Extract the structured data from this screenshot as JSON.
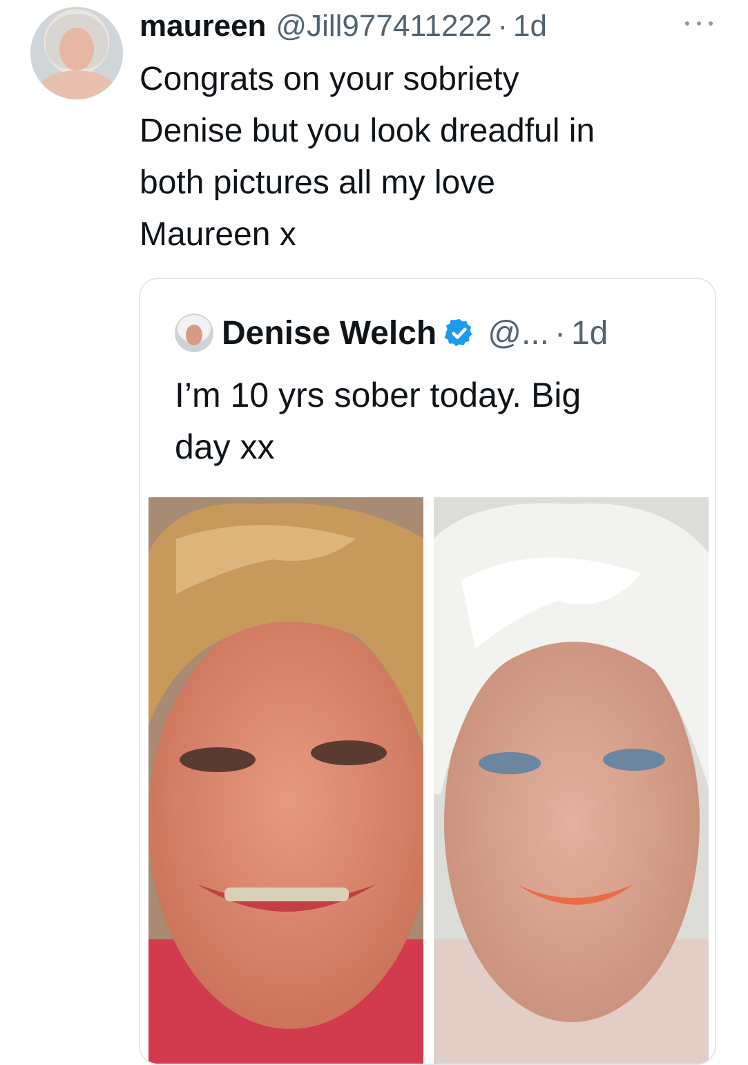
{
  "tweet": {
    "display_name": "maureen",
    "handle": "@Jill977411222",
    "separator": "·",
    "time": "1d",
    "text": "Congrats on your sobriety\nDenise but you look dreadful in\nboth pictures all my love\nMaureen x",
    "more_icon": "more-horizontal-icon"
  },
  "quoted_tweet": {
    "display_name": "Denise Welch",
    "verified_icon": "verified-badge-icon",
    "handle": "@...",
    "separator": "·",
    "time": "1d",
    "text": "I’m 10 yrs sober today. Big\nday xx",
    "media": [
      {
        "name": "photo-before"
      },
      {
        "name": "photo-after"
      }
    ]
  },
  "colors": {
    "text_primary": "#0f1419",
    "text_secondary": "#536471",
    "border": "#e1e8ed",
    "verified_blue": "#1d9bf0"
  }
}
